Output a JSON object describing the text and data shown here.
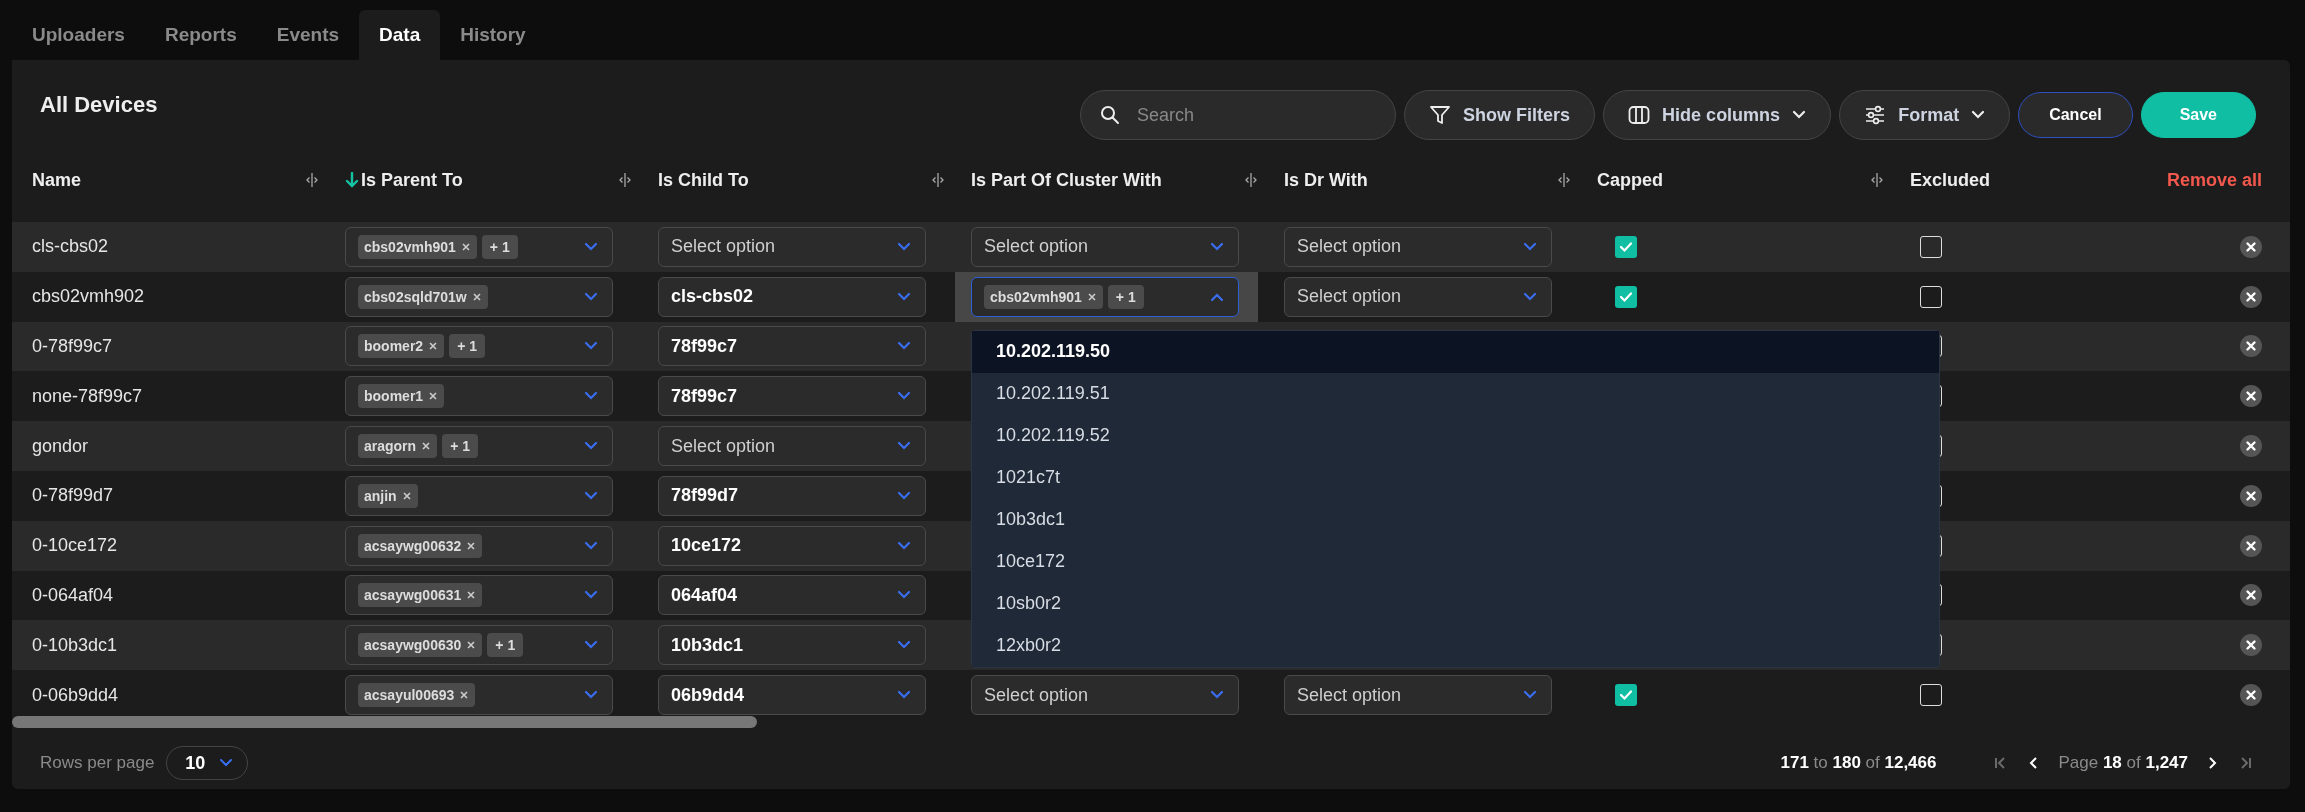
{
  "tabs": [
    {
      "label": "Uploaders",
      "selected": false
    },
    {
      "label": "Reports",
      "selected": false
    },
    {
      "label": "Events",
      "selected": false
    },
    {
      "label": "Data",
      "selected": true
    },
    {
      "label": "History",
      "selected": false
    }
  ],
  "title": "All Devices",
  "toolbar": {
    "search": {
      "placeholder": "Search"
    },
    "buttons": [
      {
        "label": "Show Filters",
        "kind": "filter"
      },
      {
        "label": "Hide columns",
        "kind": "columns"
      },
      {
        "label": "Format",
        "kind": "format"
      },
      {
        "label": "Cancel",
        "kind": "cancel"
      },
      {
        "label": "Save",
        "kind": "save"
      }
    ]
  },
  "columns": [
    {
      "label": "Name",
      "sorted": false,
      "resizable": true
    },
    {
      "label": "Is Parent To",
      "sorted": true,
      "resizable": true
    },
    {
      "label": "Is Child To",
      "sorted": false,
      "resizable": true
    },
    {
      "label": "Is Part Of Cluster With",
      "sorted": false,
      "resizable": true
    },
    {
      "label": "Is Dr With",
      "sorted": false,
      "resizable": true
    },
    {
      "label": "Capped",
      "sorted": false,
      "resizable": true
    },
    {
      "label": "Excluded",
      "sorted": false,
      "resizable": false
    }
  ],
  "remove_all": "Remove all",
  "rows": [
    {
      "name": "cls-cbs02",
      "parent": {
        "tags": [
          "cbs02vmh901"
        ],
        "more": "+ 1"
      },
      "child": {
        "placeholder": "Select option"
      },
      "cluster": {
        "placeholder": "Select option"
      },
      "dr": {
        "placeholder": "Select option"
      },
      "capped": true,
      "excluded": false
    },
    {
      "name": "cbs02vmh902",
      "parent": {
        "tags": [
          "cbs02sqld701w"
        ]
      },
      "child": {
        "value": "cls-cbs02"
      },
      "cluster": {
        "tags": [
          "cbs02vmh901"
        ],
        "more": "+ 1",
        "open": true,
        "options": [
          {
            "label": "10.202.119.50",
            "highlighted": true
          },
          {
            "label": "10.202.119.51",
            "highlighted": false
          },
          {
            "label": "10.202.119.52",
            "highlighted": false
          },
          {
            "label": "1021c7t",
            "highlighted": false
          },
          {
            "label": "10b3dc1",
            "highlighted": false
          },
          {
            "label": "10ce172",
            "highlighted": false
          },
          {
            "label": "10sb0r2",
            "highlighted": false
          },
          {
            "label": "12xb0r2",
            "highlighted": false
          }
        ]
      },
      "dr": {
        "placeholder": "Select option"
      },
      "capped": true,
      "excluded": false
    },
    {
      "name": "0-78f99c7",
      "parent": {
        "tags": [
          "boomer2"
        ],
        "more": "+ 1"
      },
      "child": {
        "value": "78f99c7"
      },
      "excluded": false
    },
    {
      "name": "none-78f99c7",
      "parent": {
        "tags": [
          "boomer1"
        ]
      },
      "child": {
        "value": "78f99c7"
      },
      "excluded": false
    },
    {
      "name": "gondor",
      "parent": {
        "tags": [
          "aragorn"
        ],
        "more": "+ 1"
      },
      "child": {
        "placeholder": "Select option"
      },
      "excluded": false
    },
    {
      "name": "0-78f99d7",
      "parent": {
        "tags": [
          "anjin"
        ]
      },
      "child": {
        "value": "78f99d7"
      },
      "excluded": false
    },
    {
      "name": "0-10ce172",
      "parent": {
        "tags": [
          "acsaywg00632"
        ]
      },
      "child": {
        "value": "10ce172"
      },
      "excluded": false
    },
    {
      "name": "0-064af04",
      "parent": {
        "tags": [
          "acsaywg00631"
        ]
      },
      "child": {
        "value": "064af04"
      },
      "excluded": false
    },
    {
      "name": "0-10b3dc1",
      "parent": {
        "tags": [
          "acsaywg00630"
        ],
        "more": "+ 1"
      },
      "child": {
        "value": "10b3dc1"
      },
      "excluded": false
    },
    {
      "name": "0-06b9dd4",
      "parent": {
        "tags": [
          "acsayul00693"
        ]
      },
      "child": {
        "value": "06b9dd4"
      },
      "cluster": {
        "placeholder": "Select option"
      },
      "dr": {
        "placeholder": "Select option"
      },
      "capped": true,
      "excluded": false
    }
  ],
  "footer": {
    "rows_per_page_label": "Rows per page",
    "rows_per_page": "10",
    "range": "**171** to **180** of **12,466**",
    "page": "Page **18** of **1,247**",
    "nav": [
      {
        "kind": "first",
        "disabled": true
      },
      {
        "kind": "prev",
        "disabled": false
      },
      {
        "kind": "next",
        "disabled": false
      },
      {
        "kind": "last",
        "disabled": true
      }
    ]
  }
}
